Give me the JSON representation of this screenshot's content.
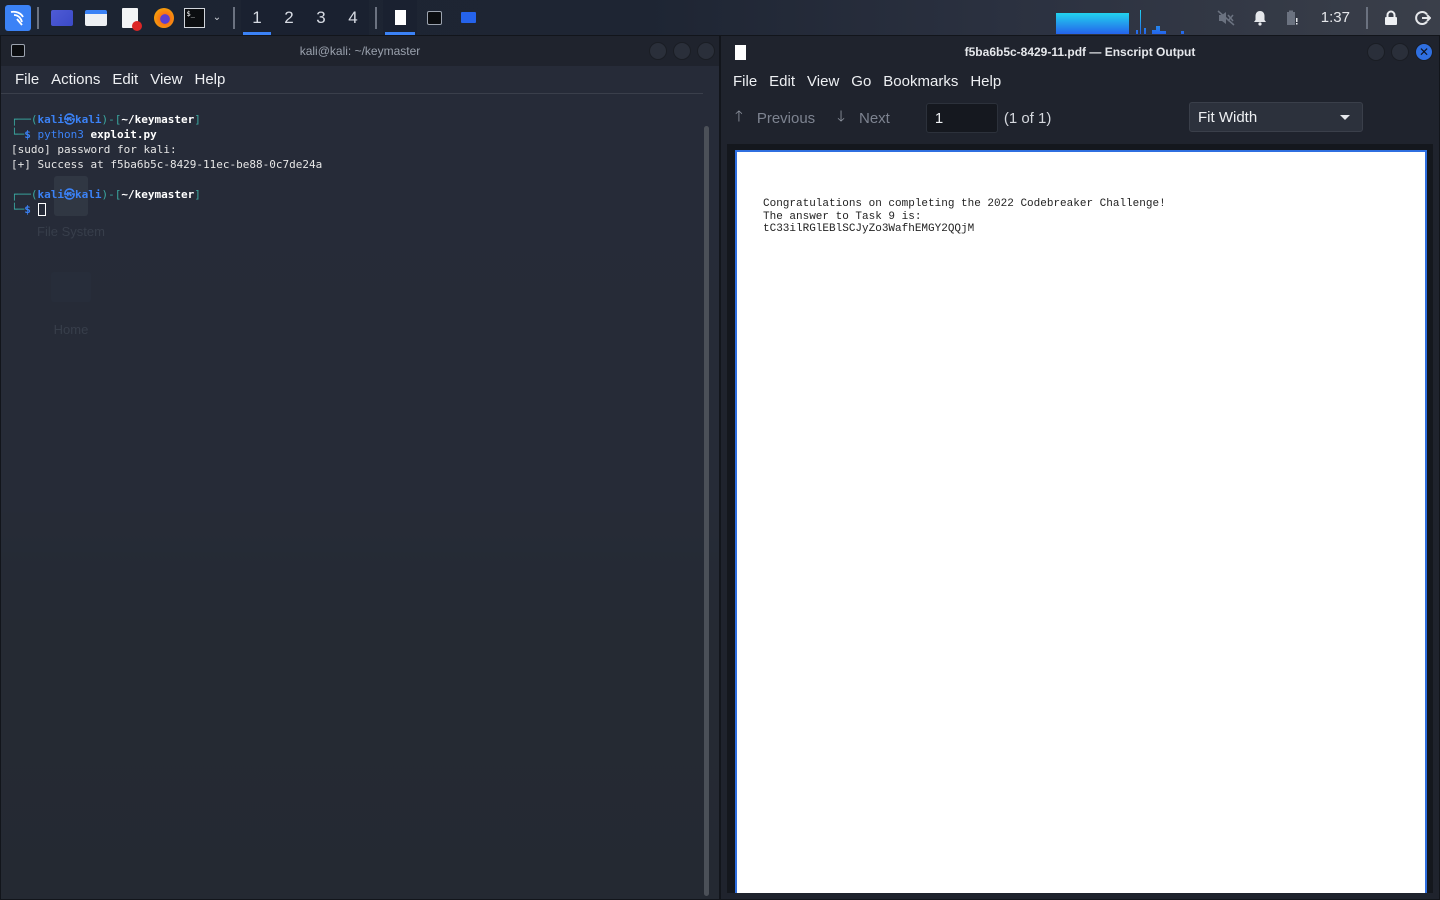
{
  "taskbar": {
    "workspaces": [
      "1",
      "2",
      "3",
      "4"
    ],
    "active_workspace": "1",
    "launchers": [
      {
        "name": "show-desktop",
        "icon": "desktop-icon"
      },
      {
        "name": "file-manager",
        "icon": "folder-icon"
      },
      {
        "name": "text-editor",
        "icon": "text-editor-icon"
      },
      {
        "name": "firefox",
        "icon": "firefox-icon"
      },
      {
        "name": "terminal",
        "icon": "terminal-icon"
      }
    ],
    "tasks": [
      {
        "name": "pdf-viewer",
        "icon": "document-icon",
        "active": true
      },
      {
        "name": "terminal",
        "icon": "terminal-icon",
        "active": false
      },
      {
        "name": "file-manager",
        "icon": "folder-icon",
        "active": false
      }
    ],
    "clock": "1:37",
    "tray": [
      "volume-muted-icon",
      "notification-bell-icon",
      "battery-icon",
      "lock-icon",
      "logout-icon"
    ]
  },
  "desktop": {
    "icons": [
      {
        "label": "File System"
      },
      {
        "label": "Home"
      }
    ]
  },
  "terminal": {
    "title": "kali@kali: ~/keymaster",
    "menu": [
      "File",
      "Actions",
      "Edit",
      "View",
      "Help"
    ],
    "prompt": {
      "user": "kali",
      "at": "㉿",
      "host": "kali",
      "cwd": "~/keymaster"
    },
    "command_bin": "python3",
    "command_arg": "exploit.py",
    "output": [
      "[sudo] password for kali:",
      "[+] Success at f5ba6b5c-8429-11ec-be88-0c7de24a"
    ]
  },
  "viewer": {
    "title": "f5ba6b5c-8429-11.pdf — Enscript Output",
    "menu": [
      "File",
      "Edit",
      "View",
      "Go",
      "Bookmarks",
      "Help"
    ],
    "toolbar": {
      "previous_label": "Previous",
      "next_label": "Next",
      "page_value": "1",
      "page_count": "(1 of 1)",
      "zoom_value": "Fit Width"
    },
    "document_lines": [
      "Congratulations on completing the 2022 Codebreaker Challenge!",
      "The answer to Task 9 is:",
      "tC33ilRGlEBlSCJyZo3WafhEMGY2QQjM"
    ]
  }
}
